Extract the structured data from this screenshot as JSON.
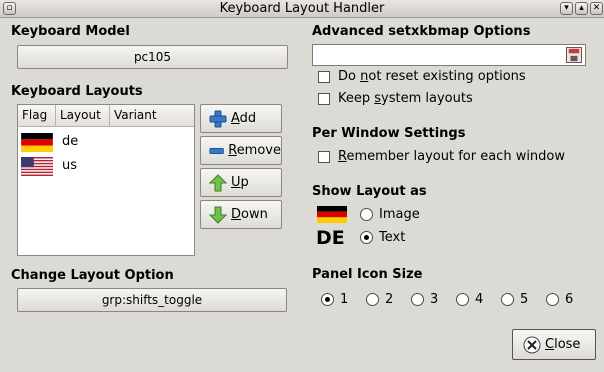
{
  "window": {
    "title": "Keyboard Layout Handler"
  },
  "model": {
    "title": "Keyboard Model",
    "value": "pc105"
  },
  "layouts": {
    "title": "Keyboard Layouts",
    "columns": [
      "Flag",
      "Layout",
      "Variant"
    ],
    "rows": [
      {
        "code": "de",
        "flag": "germany-flag-icon"
      },
      {
        "code": "us",
        "flag": "usa-flag-icon"
      }
    ]
  },
  "buttons": {
    "add": {
      "prefix": "",
      "mnemonic": "A",
      "rest": "dd"
    },
    "remove": {
      "prefix": "",
      "mnemonic": "R",
      "rest": "emove"
    },
    "up": {
      "prefix": "",
      "mnemonic": "U",
      "rest": "p"
    },
    "down": {
      "prefix": "",
      "mnemonic": "D",
      "rest": "own"
    },
    "close": {
      "prefix": "",
      "mnemonic": "C",
      "rest": "lose"
    }
  },
  "change_option": {
    "title": "Change Layout Option",
    "value": "grp:shifts_toggle"
  },
  "advanced": {
    "title": "Advanced setxkbmap Options",
    "entry_value": "",
    "do_not_reset": {
      "pre": "Do ",
      "mn": "n",
      "post": "ot reset existing options",
      "checked": false
    },
    "keep_system": {
      "pre": "Keep ",
      "mn": "s",
      "post": "ystem layouts",
      "checked": false
    }
  },
  "per_window": {
    "title": "Per Window Settings",
    "remember": {
      "pre": "",
      "mn": "R",
      "post": "emember layout for each window",
      "checked": false
    }
  },
  "show_layout": {
    "title": "Show Layout as",
    "image_label": "Image",
    "text_label": "Text",
    "text_preview": "DE",
    "selected": "Text"
  },
  "panel_icon": {
    "title": "Panel Icon Size",
    "options": [
      "1",
      "2",
      "3",
      "4",
      "5",
      "6"
    ],
    "selected": "1"
  },
  "colors": {
    "background": "#dcdad5",
    "de_black": "#000000",
    "de_red": "#dd0000",
    "de_gold": "#ffce00",
    "us_red": "#b22234",
    "us_blue": "#3c3b6e"
  }
}
